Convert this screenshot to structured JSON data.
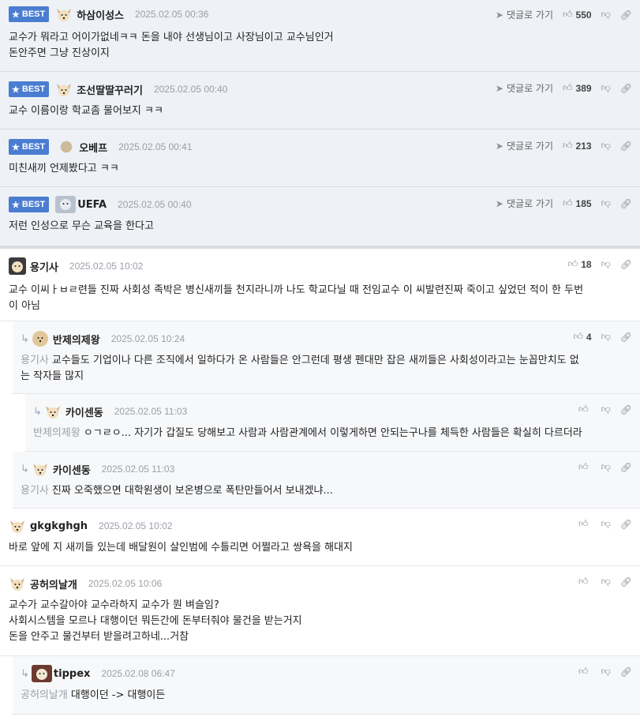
{
  "badge_label": "BEST",
  "reply_to_label": "댓글로 가기",
  "best": [
    {
      "nick": "하삼이성스",
      "date": "2025.02.05 00:36",
      "likes": "550",
      "lines": [
        "교수가 뭐라고 어이가없네ㅋㅋ 돈을 내야 선생님이고 사장님이고 교수님인거",
        "돈안주면 그냥 진상이지"
      ]
    },
    {
      "nick": "조선딸딸꾸러기",
      "date": "2025.02.05 00:40",
      "likes": "389",
      "lines": [
        "교수 이름이랑 학교좀 물어보지 ㅋㅋ"
      ]
    },
    {
      "nick": "오베프",
      "date": "2025.02.05 00:41",
      "likes": "213",
      "lines": [
        "미친새끼 언제봤다고 ㅋㅋ"
      ]
    },
    {
      "nick": "UEFA",
      "date": "2025.02.05 00:40",
      "likes": "185",
      "lines": [
        "저런 인성으로 무슨 교육을 한다고"
      ]
    }
  ],
  "comments": [
    {
      "nick": "용기사",
      "date": "2025.02.05 10:02",
      "likes": "18",
      "reply_to": "",
      "lines": [
        "교수 이씨ㅏㅂㄹ련들 진짜 사회성 족박은 병신새끼들 천지라니까 나도 학교다닐 때 전임교수 이 씨발련진짜 죽이고 싶었던 적이 한 두번",
        "이 아님"
      ]
    },
    {
      "nick": "반제의제왕",
      "date": "2025.02.05 10:24",
      "likes": "4",
      "reply_to": "용기사",
      "lines": [
        "교수들도 기업이나 다른 조직에서 일하다가 온 사람들은 안그런데 평생 펜대만 잡은 새끼들은 사회성이라고는 눈꼽만치도 없",
        "는 작자들 많지"
      ]
    },
    {
      "nick": "카이센동",
      "date": "2025.02.05 11:03",
      "likes": "",
      "reply_to": "반제의제왕",
      "lines": [
        "ㅇㄱㄹㅇ... 자기가 갑질도 당해보고 사람과 사람관계에서 이렇게하면 안되는구나를 체득한 사람들은 확실히 다르더라"
      ]
    },
    {
      "nick": "카이센동",
      "date": "2025.02.05 11:03",
      "likes": "",
      "reply_to": "용기사",
      "lines": [
        "진짜 오죽했으면 대학원생이 보온병으로 폭탄만들어서 보내겠냐..."
      ]
    },
    {
      "nick": "gkgkghgh",
      "date": "2025.02.05 10:02",
      "likes": "",
      "reply_to": "",
      "lines": [
        "바로 앞에 지 새끼들 있는데 배달원이 살인범에 수틀리면 어쩔라고 쌍욕을 해대지"
      ]
    },
    {
      "nick": "공허의날개",
      "date": "2025.02.05 10:06",
      "likes": "",
      "reply_to": "",
      "lines": [
        "교수가 교수갈아야 교수라하지 교수가 뭔 벼슬임?",
        "사회시스템을 모르나 대행이던 뭐든간에 돈부터줘야 물건을 받는거지",
        "돈을 안주고 물건부터 받을려고하네...거참"
      ]
    },
    {
      "nick": "tippex",
      "date": "2025.02.08 06:47",
      "likes": "",
      "reply_to": "공허의날개",
      "lines": [
        "대행이던 -> 대행이든"
      ]
    }
  ]
}
